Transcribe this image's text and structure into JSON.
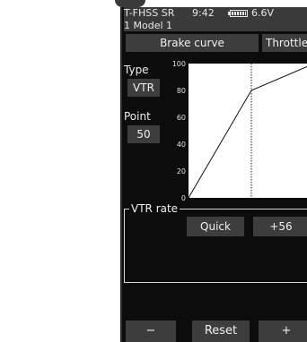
{
  "status": {
    "system": "T-FHSS SR",
    "time": "9:42",
    "battery_icon": "battery-icon",
    "voltage": "6.6V"
  },
  "model": {
    "label": "1  Model 1"
  },
  "tabs": [
    {
      "label": "Brake curve"
    },
    {
      "label": "Throttle"
    }
  ],
  "type": {
    "label": "Type",
    "value": "VTR"
  },
  "point": {
    "label": "Point",
    "value": "50"
  },
  "chart_data": {
    "type": "line",
    "x": [
      0,
      50,
      100
    ],
    "values": [
      0,
      80,
      100
    ],
    "ylim": [
      0,
      100
    ],
    "yticks": [
      "100",
      "80",
      "60",
      "40",
      "20",
      "0"
    ],
    "marker_x": 50,
    "grid": false
  },
  "vtr": {
    "title": "VTR rate",
    "mode": "Quick",
    "rate": "+56"
  },
  "bottom": {
    "minus": "−",
    "reset": "Reset",
    "plus": "+"
  }
}
